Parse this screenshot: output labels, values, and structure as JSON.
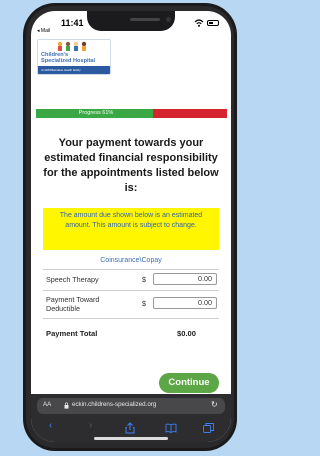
{
  "statusbar": {
    "time": "11:41",
    "back_label": "◂ Mail"
  },
  "logo": {
    "line1": "Children's",
    "line2": "Specialized Hospital",
    "tagline": "An RWJBarnabas Health facility"
  },
  "progress": {
    "label": "Progress 61%",
    "value": 0.61,
    "fill_color": "#3aa845",
    "track_color": "#d6242e"
  },
  "heading": "Your payment towards your estimated financial responsibility for the appointments listed below is:",
  "notice": "The amount due shown below is an estimated amount. This amount is subject to change.",
  "section_label": "Coinsurance\\Copay",
  "rows": [
    {
      "label": "Speech Therapy",
      "currency": "$",
      "value": "0.00"
    },
    {
      "label": "Payment Toward Deductible",
      "currency": "$",
      "value": "0.00"
    }
  ],
  "total": {
    "label": "Payment Total",
    "value": "$0.00"
  },
  "continue_label": "Continue",
  "browser": {
    "aa": "AA",
    "url": "eckin.childrens-specialized.org",
    "toolbar_icons": [
      "back-icon",
      "forward-icon",
      "share-icon",
      "bookmarks-icon",
      "tabs-icon"
    ]
  },
  "colors": {
    "accent_blue": "#3a6fb5",
    "notice_bg": "#fff600",
    "button_green": "#5da646"
  }
}
